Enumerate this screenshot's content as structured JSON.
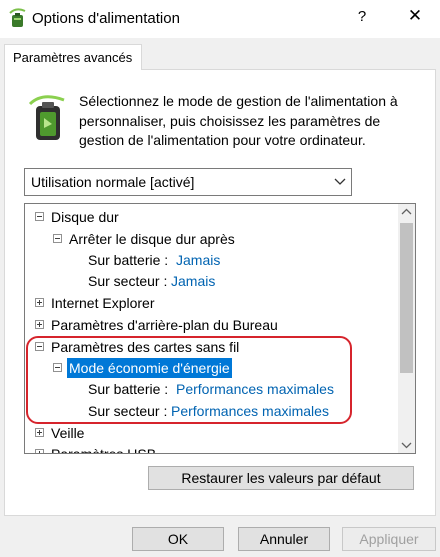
{
  "window": {
    "title": "Options d'alimentation",
    "help_label": "?",
    "close_label": "✕"
  },
  "tab": {
    "label": "Paramètres avancés"
  },
  "description": "Sélectionnez le mode de gestion de l'alimentation à personnaliser, puis choisissez les paramètres de gestion de l'alimentation pour votre ordinateur.",
  "plan_select": {
    "value": "Utilisation normale [activé]"
  },
  "tree": {
    "disque_dur": "Disque dur",
    "arreter_disque": "Arrêter le disque dur après",
    "sur_batterie_1_label": "Sur batterie :",
    "sur_batterie_1_value": "Jamais",
    "sur_secteur_1_label": "Sur secteur :",
    "sur_secteur_1_value": "Jamais",
    "internet_explorer": "Internet Explorer",
    "arriere_plan": "Paramètres d'arrière-plan du Bureau",
    "cartes_sans_fil": "Paramètres des cartes sans fil",
    "mode_economie": "Mode économie d'énergie",
    "sur_batterie_2_label": "Sur batterie :",
    "sur_batterie_2_value": "Performances maximales",
    "sur_secteur_2_label": "Sur secteur :",
    "sur_secteur_2_value": "Performances maximales",
    "veille": "Veille",
    "usb": "Paramètres USB"
  },
  "buttons": {
    "restore": "Restaurer les valeurs par défaut",
    "ok": "OK",
    "cancel": "Annuler",
    "apply": "Appliquer"
  },
  "colors": {
    "link": "#0063b1",
    "selection": "#0078d7",
    "highlight_outline": "#d6242c"
  }
}
